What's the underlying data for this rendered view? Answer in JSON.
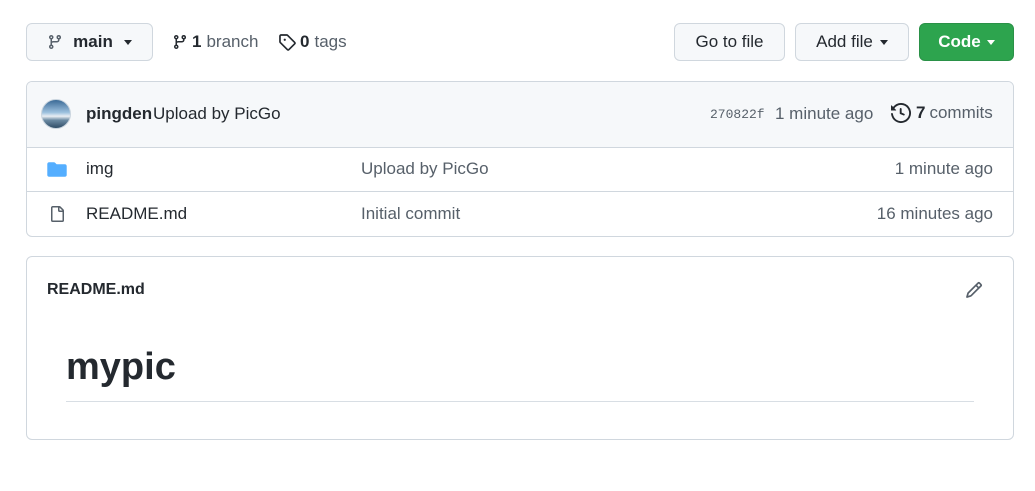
{
  "toolbar": {
    "branch_button": "main",
    "branch_count": "1",
    "branch_word": "branch",
    "tag_count": "0",
    "tag_word": "tags",
    "go_to_file": "Go to file",
    "add_file": "Add file",
    "code": "Code"
  },
  "commit": {
    "author": "pingden",
    "message": "Upload by PicGo",
    "hash": "270822f",
    "time": "1 minute ago",
    "commit_count": "7",
    "commit_word": "commits"
  },
  "files": [
    {
      "name": "img",
      "icon": "folder-icon",
      "message": "Upload by PicGo",
      "age": "1 minute ago"
    },
    {
      "name": "README.md",
      "icon": "file-icon",
      "message": "Initial commit",
      "age": "16 minutes ago"
    }
  ],
  "readme": {
    "filename": "README.md",
    "heading": "mypic"
  },
  "colors": {
    "primary_button": "#2da44e",
    "folder": "#54aeff",
    "border": "#d0d7de"
  }
}
